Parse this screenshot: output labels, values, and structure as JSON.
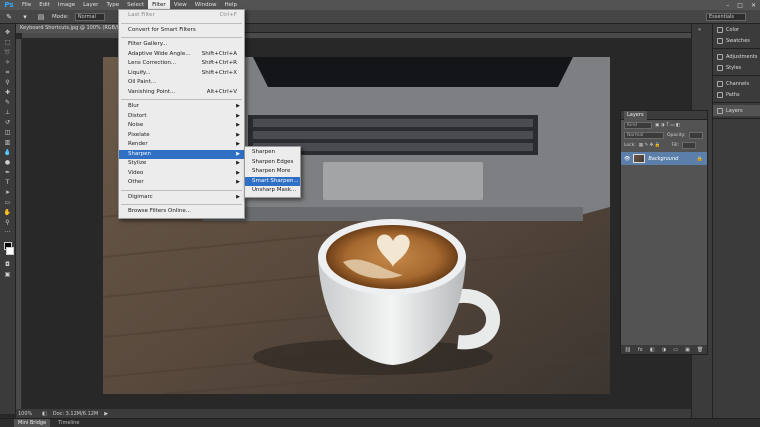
{
  "app": {
    "logo": "Ps",
    "menus": [
      "File",
      "Edit",
      "Image",
      "Layer",
      "Type",
      "Select",
      "Filter",
      "View",
      "Window",
      "Help"
    ],
    "active_menu": "Filter",
    "window_controls": [
      "–",
      "□",
      "✕"
    ]
  },
  "options_bar": {
    "mode_label": "Mode:",
    "mode_value": "Normal",
    "workspace": "Essentials"
  },
  "document": {
    "tab_title": "Keyboard Shortcuts.jpg @ 100% (RGB/8#)",
    "tab_close": "×"
  },
  "filter_menu": {
    "items": [
      {
        "label": "Last Filter",
        "shortcut": "Ctrl+F",
        "disabled": true
      },
      {
        "sep": true
      },
      {
        "label": "Convert for Smart Filters"
      },
      {
        "sep": true
      },
      {
        "label": "Filter Gallery..."
      },
      {
        "label": "Adaptive Wide Angle...",
        "shortcut": "Shift+Ctrl+A"
      },
      {
        "label": "Lens Correction...",
        "shortcut": "Shift+Ctrl+R"
      },
      {
        "label": "Liquify...",
        "shortcut": "Shift+Ctrl+X"
      },
      {
        "label": "Oil Paint..."
      },
      {
        "label": "Vanishing Point...",
        "shortcut": "Alt+Ctrl+V"
      },
      {
        "sep": true
      },
      {
        "label": "Blur",
        "submenu": true
      },
      {
        "label": "Distort",
        "submenu": true
      },
      {
        "label": "Noise",
        "submenu": true
      },
      {
        "label": "Pixelate",
        "submenu": true
      },
      {
        "label": "Render",
        "submenu": true
      },
      {
        "label": "Sharpen",
        "submenu": true,
        "highlighted": true
      },
      {
        "label": "Stylize",
        "submenu": true
      },
      {
        "label": "Video",
        "submenu": true
      },
      {
        "label": "Other",
        "submenu": true
      },
      {
        "sep": true
      },
      {
        "label": "Digimarc",
        "submenu": true
      },
      {
        "sep": true
      },
      {
        "label": "Browse Filters Online..."
      }
    ]
  },
  "sharpen_submenu": {
    "items": [
      {
        "label": "Sharpen"
      },
      {
        "label": "Sharpen Edges"
      },
      {
        "label": "Sharpen More"
      },
      {
        "label": "Smart Sharpen...",
        "highlighted": true
      },
      {
        "label": "Unsharp Mask..."
      }
    ]
  },
  "right_dock": {
    "groups": [
      [
        "Color",
        "Swatches"
      ],
      [
        "Adjustments",
        "Styles"
      ],
      [
        "Channels",
        "Paths"
      ],
      [
        "Layers"
      ]
    ],
    "active": "Layers"
  },
  "layers_panel": {
    "tab": "Layers",
    "kind_label": "Kind",
    "blend_mode": "Normal",
    "opacity_label": "Opacity:",
    "lock_label": "Lock:",
    "fill_label": "Fill:",
    "layer_name": "Background",
    "footer_icons": [
      "⛓",
      "fx",
      "◧",
      "◑",
      "▭",
      "▣",
      "🗑"
    ]
  },
  "status": {
    "zoom": "100%",
    "doc_size": "Doc: 3.12M/6.12M"
  },
  "bottom_tabs": [
    "Mini Bridge",
    "Timeline"
  ],
  "bottom_active": "Mini Bridge",
  "colors": {
    "menu_highlight": "#2f6fc4",
    "app_bg": "#282828",
    "panel_bg": "#535353"
  }
}
